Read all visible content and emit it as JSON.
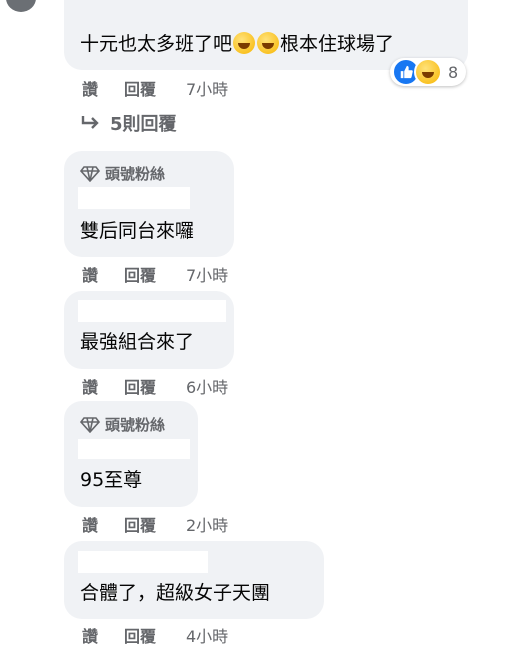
{
  "top_comment": {
    "text_before": "十元也太多班了吧",
    "text_after": "根本住球場了",
    "emoji_icon": "grinning-sweat-emoji",
    "like_label": "讚",
    "reply_label": "回覆",
    "time": "7小時",
    "reaction_count": "8"
  },
  "view_replies": {
    "label": "5則回覆"
  },
  "replies": [
    {
      "badge": "頭號粉絲",
      "text": "雙后同台來囉",
      "like_label": "讚",
      "reply_label": "回覆",
      "time": "7小時"
    },
    {
      "badge": "",
      "text": "最強組合來了",
      "like_label": "讚",
      "reply_label": "回覆",
      "time": "6小時"
    },
    {
      "badge": "頭號粉絲",
      "text": "95至尊",
      "like_label": "讚",
      "reply_label": "回覆",
      "time": "2小時"
    },
    {
      "badge": "",
      "text": "合體了，超級女子天團",
      "like_label": "讚",
      "reply_label": "回覆",
      "time": "4小時"
    }
  ],
  "colors": {
    "bubble": "#f0f2f5",
    "meta_text": "#65676b",
    "like_blue": "#1877f2"
  }
}
